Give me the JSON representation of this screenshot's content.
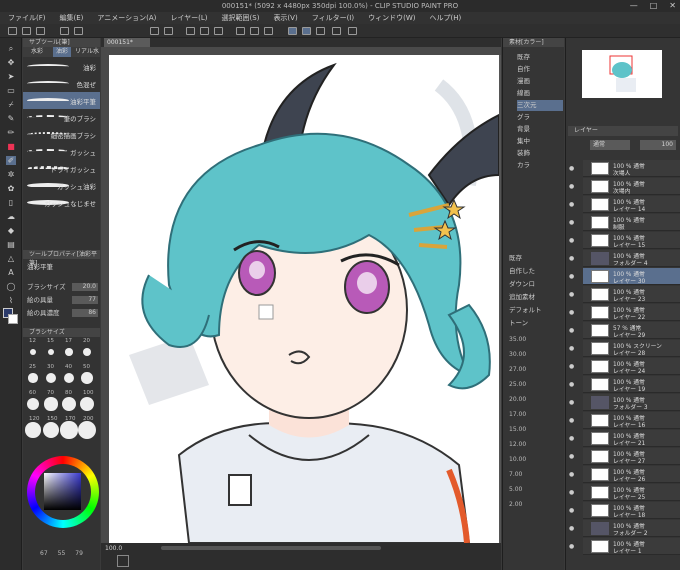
{
  "window": {
    "title": "000151* (5092 x 4480px 350dpi 100.0%) - CLIP STUDIO PAINT PRO",
    "controls": [
      "—",
      "□",
      "✕"
    ]
  },
  "menu": [
    "ファイル(F)",
    "編集(E)",
    "アニメーション(A)",
    "レイヤー(L)",
    "選択範囲(S)",
    "表示(V)",
    "フィルター(I)",
    "ウィンドウ(W)",
    "ヘルプ(H)"
  ],
  "canvas_tab": "000151*",
  "subtool": {
    "panel_title": "サブツール[筆]",
    "tabs": [
      "水彩",
      "油彩",
      "リアル水"
    ],
    "brushes": [
      "油彩",
      "色混ぜ",
      "油彩平筆",
      "筆のブラシ",
      "細密描画ブラシ",
      "ガッシュ",
      "ドライガッシュ",
      "ガッシュ油彩",
      "ガッシュなじませ"
    ],
    "selected_index": 2
  },
  "tool_property": {
    "title": "ツールプロパティ[油彩平筆]",
    "name": "油彩平筆",
    "rows": [
      {
        "label": "ブラシサイズ",
        "value": "20.0"
      },
      {
        "label": "絵の具量",
        "value": "77"
      },
      {
        "label": "絵の具濃度",
        "value": "86"
      }
    ]
  },
  "brush_size": {
    "title": "ブラシサイズ",
    "sizes": [
      "12",
      "15",
      "17",
      "20",
      "25",
      "30",
      "40",
      "50",
      "60",
      "70",
      "80",
      "100",
      "120",
      "150",
      "170",
      "200"
    ]
  },
  "color_slots": [
    "67",
    "55",
    "79"
  ],
  "mid_panel": {
    "title": "素材[カラー]",
    "items": [
      "既存",
      "自作",
      "漫画",
      "線画",
      "三次元",
      "グラ",
      "背景",
      "集中",
      "装飾",
      "カラ"
    ],
    "bottom_items": [
      "既存",
      "自作した",
      "ダウンロ",
      "追加素材",
      "デフォルト",
      "トーン"
    ]
  },
  "percent_rows": [
    "35.00",
    "30.00",
    "27.00",
    "25.00",
    "20.00",
    "17.00",
    "15.00",
    "12.00",
    "10.00",
    "7.00",
    "5.00",
    "2.00"
  ],
  "status": {
    "zoom": "100.0"
  },
  "layers": {
    "panel_title": "レイヤー",
    "blend": "通常",
    "opacity": "100",
    "items": [
      {
        "l1": "100 % 通常",
        "l2": "次場人",
        "folder": false
      },
      {
        "l1": "100 % 通常",
        "l2": "次場内",
        "folder": false
      },
      {
        "l1": "100 % 通常",
        "l2": "レイヤー 14",
        "folder": false
      },
      {
        "l1": "100 % 通常",
        "l2": "制服",
        "folder": false
      },
      {
        "l1": "100 % 通常",
        "l2": "レイヤー 15",
        "folder": false
      },
      {
        "l1": "100 % 通常",
        "l2": "フォルダー 4",
        "folder": true
      },
      {
        "l1": "100 % 通常",
        "l2": "レイヤー 30",
        "folder": false
      },
      {
        "l1": "100 % 通常",
        "l2": "レイヤー 23",
        "folder": false
      },
      {
        "l1": "100 % 通常",
        "l2": "レイヤー 22",
        "folder": false
      },
      {
        "l1": "57 % 通常",
        "l2": "レイヤー 29",
        "folder": false
      },
      {
        "l1": "100 % スクリーン",
        "l2": "レイヤー 28",
        "folder": false
      },
      {
        "l1": "100 % 通常",
        "l2": "レイヤー 24",
        "folder": false
      },
      {
        "l1": "100 % 通常",
        "l2": "レイヤー 19",
        "folder": false
      },
      {
        "l1": "100 % 通常",
        "l2": "フォルダー 3",
        "folder": true
      },
      {
        "l1": "100 % 通常",
        "l2": "レイヤー 16",
        "folder": false
      },
      {
        "l1": "100 % 通常",
        "l2": "レイヤー 21",
        "folder": false
      },
      {
        "l1": "100 % 通常",
        "l2": "レイヤー 27",
        "folder": false
      },
      {
        "l1": "100 % 通常",
        "l2": "レイヤー 26",
        "folder": false
      },
      {
        "l1": "100 % 通常",
        "l2": "レイヤー 25",
        "folder": false
      },
      {
        "l1": "100 % 通常",
        "l2": "レイヤー 18",
        "folder": false
      },
      {
        "l1": "100 % 通常",
        "l2": "フォルダー 2",
        "folder": true
      },
      {
        "l1": "100 % 通常",
        "l2": "レイヤー 1",
        "folder": false
      }
    ],
    "selected_index": 6
  }
}
